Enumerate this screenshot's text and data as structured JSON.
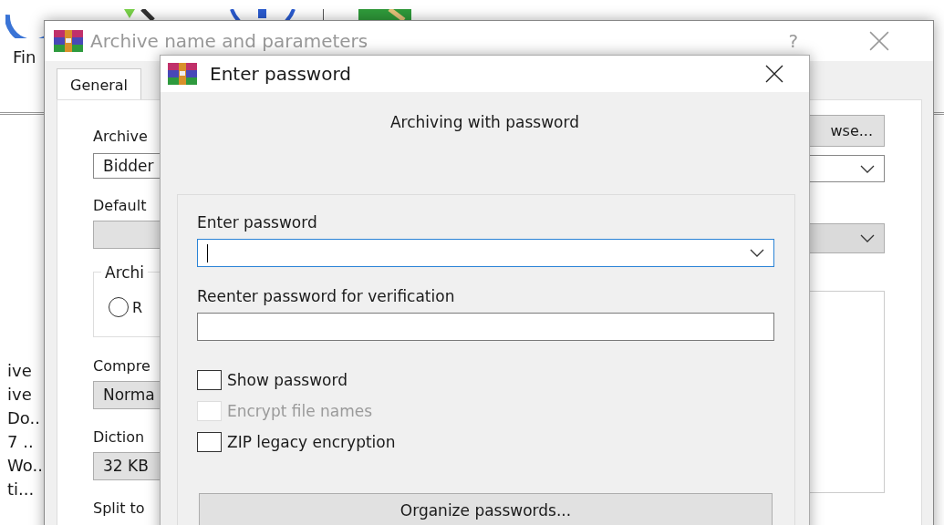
{
  "main_window": {
    "menu_label": "Fin",
    "file_list": [
      "ive",
      "ive",
      "Do..",
      "7 ..",
      "Wo..",
      "ti..."
    ]
  },
  "archive_dialog": {
    "title": "Archive name and parameters",
    "active": false,
    "help": "?",
    "tabs": [
      {
        "label": "General",
        "selected": true
      }
    ],
    "left_column": [
      {
        "kind": "label",
        "text": "Archive"
      },
      {
        "kind": "field",
        "text": "Bidder"
      },
      {
        "kind": "label",
        "text": "Default"
      },
      {
        "kind": "dropdown"
      },
      {
        "kind": "group",
        "text": "Archi",
        "radio": {
          "label": "R",
          "selected": false
        }
      },
      {
        "kind": "label",
        "text": "Compre"
      },
      {
        "kind": "dropdown",
        "text": "Norma"
      },
      {
        "kind": "label",
        "text": "Diction"
      },
      {
        "kind": "dropdown",
        "text": "32 KB"
      },
      {
        "kind": "label",
        "text": "Split to"
      }
    ],
    "browse_button": "wse..."
  },
  "password_dialog": {
    "title": "Enter password",
    "subtitle": "Archiving with password",
    "fields": [
      {
        "label": "Enter password",
        "focused": true,
        "dropdown": true
      },
      {
        "label": "Reenter password for verification",
        "focused": false,
        "dropdown": false
      }
    ],
    "checkboxes": [
      {
        "label": "Show password",
        "checked": false,
        "disabled": false
      },
      {
        "label": "Encrypt file names",
        "checked": false,
        "disabled": true
      },
      {
        "label": "ZIP legacy encryption",
        "checked": false,
        "disabled": false
      }
    ],
    "organize_button": "Organize passwords..."
  }
}
